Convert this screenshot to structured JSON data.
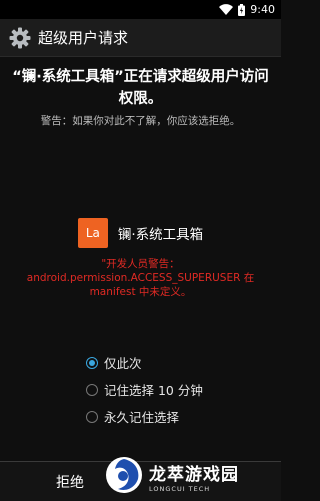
{
  "status_bar": {
    "time": "9:40"
  },
  "app_bar": {
    "title": "超级用户请求",
    "icon": "gear-icon"
  },
  "dialog": {
    "heading": "“镧·系统工具箱”正在请求超级用户访问权限。",
    "warning": "警告：如果你对此不了解，你应该选拒绝。",
    "app_icon_text": "La",
    "app_icon_color": "#ee6322",
    "app_name": "镧·系统工具箱",
    "dev_warning_line1": "\"开发人员警告：",
    "dev_warning_line2": "android.permission.ACCESS_SUPERUSER 在",
    "dev_warning_line3": "manifest 中未定义。",
    "accent_color": "#3aa7df",
    "warning_color": "#e02a24"
  },
  "options": [
    {
      "label": "仅此次",
      "checked": true
    },
    {
      "label": "记住选择 10 分钟",
      "checked": false
    },
    {
      "label": "永久记住选择",
      "checked": false
    }
  ],
  "buttons": {
    "deny": "拒绝"
  },
  "watermark": {
    "title": "龙萃游戏园",
    "subtitle": "LONGCUI TECH"
  }
}
